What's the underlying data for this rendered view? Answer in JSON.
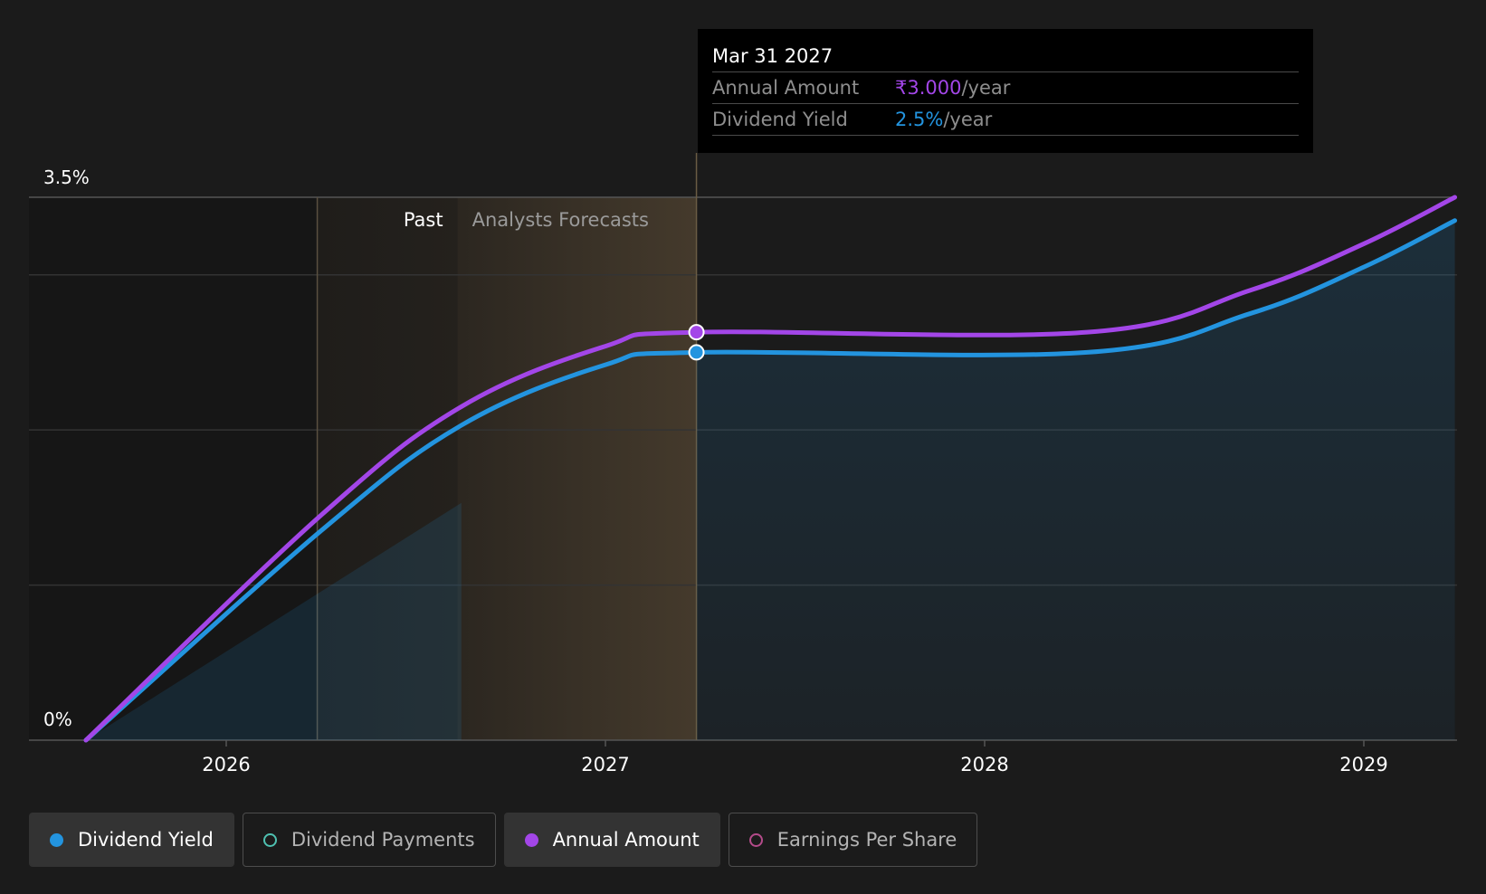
{
  "chart_data": {
    "type": "line",
    "x_ticks": [
      "2026",
      "2027",
      "2028",
      "2029"
    ],
    "y_labels": [
      "0%",
      "3.5%"
    ],
    "ylim": [
      0,
      3.5
    ],
    "regions": {
      "past_label": "Past",
      "forecast_label": "Analysts Forecasts"
    },
    "series": [
      {
        "name": "Dividend Yield",
        "color": "#2394df",
        "points": [
          {
            "x": 2025.63,
            "y": 0.0
          },
          {
            "x": 2026.25,
            "y": 1.35
          },
          {
            "x": 2026.62,
            "y": 2.03
          },
          {
            "x": 2027.0,
            "y": 2.42
          },
          {
            "x": 2027.24,
            "y": 2.5
          },
          {
            "x": 2028.27,
            "y": 2.5
          },
          {
            "x": 2028.7,
            "y": 2.75
          },
          {
            "x": 2029.0,
            "y": 3.05
          },
          {
            "x": 2029.24,
            "y": 3.35
          }
        ]
      },
      {
        "name": "Annual Amount",
        "color": "#a346e8",
        "points": [
          {
            "x": 2025.63,
            "y": 0.0
          },
          {
            "x": 2026.25,
            "y": 1.45
          },
          {
            "x": 2026.62,
            "y": 2.15
          },
          {
            "x": 2027.0,
            "y": 2.54
          },
          {
            "x": 2027.24,
            "y": 2.63
          },
          {
            "x": 2028.27,
            "y": 2.63
          },
          {
            "x": 2028.7,
            "y": 2.9
          },
          {
            "x": 2029.0,
            "y": 3.2
          },
          {
            "x": 2029.24,
            "y": 3.5
          }
        ]
      }
    ],
    "payments_area": [
      {
        "x": 2025.63,
        "y": 0.0
      },
      {
        "x": 2026.62,
        "y": 1.53
      }
    ]
  },
  "tooltip": {
    "date": "Mar 31 2027",
    "rows": [
      {
        "label": "Annual Amount",
        "value": "₹3.000",
        "unit": "/year",
        "color": "#a346e8"
      },
      {
        "label": "Dividend Yield",
        "value": "2.5%",
        "unit": "/year",
        "color": "#2394df"
      }
    ]
  },
  "legend": [
    {
      "label": "Dividend Yield",
      "color": "#2394df",
      "active": true
    },
    {
      "label": "Dividend Payments",
      "color": "#4fc1b1",
      "active": false
    },
    {
      "label": "Annual Amount",
      "color": "#a346e8",
      "active": true
    },
    {
      "label": "Earnings Per Share",
      "color": "#b44b8a",
      "active": false
    }
  ]
}
